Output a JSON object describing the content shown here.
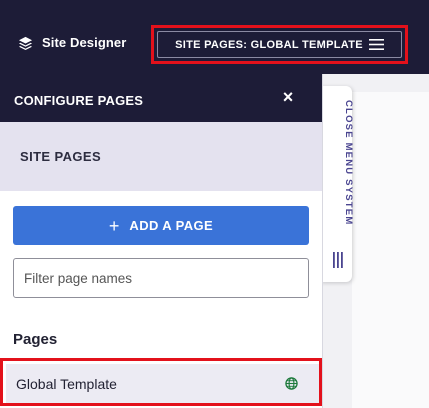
{
  "topbar": {
    "brand_label": "Site Designer",
    "brand_icon": "layers-icon",
    "site_pages_button_label": "SITE PAGES: GLOBAL TEMPLATE",
    "menu_icon": "hamburger-icon"
  },
  "panel": {
    "title": "CONFIGURE PAGES",
    "close_label": "×",
    "section_title": "SITE PAGES",
    "add_button_label": "ADD A PAGE",
    "add_button_symbol": "+",
    "filter_placeholder": "Filter page names",
    "filter_value": "",
    "pages_heading": "Pages",
    "pages": [
      {
        "label": "Global Template",
        "icon": "globe-icon"
      }
    ]
  },
  "side_tab": {
    "label": "CLOSE MENU SYSTEM",
    "icon": "vertical-bars-icon"
  },
  "colors": {
    "dark_navy": "#1d1c37",
    "accent_blue": "#3a73d8",
    "highlight_red": "#e3111b",
    "section_lavender": "#e4e2ef",
    "globe_green": "#1e7a3c",
    "tab_text_purple": "#4a4590"
  }
}
